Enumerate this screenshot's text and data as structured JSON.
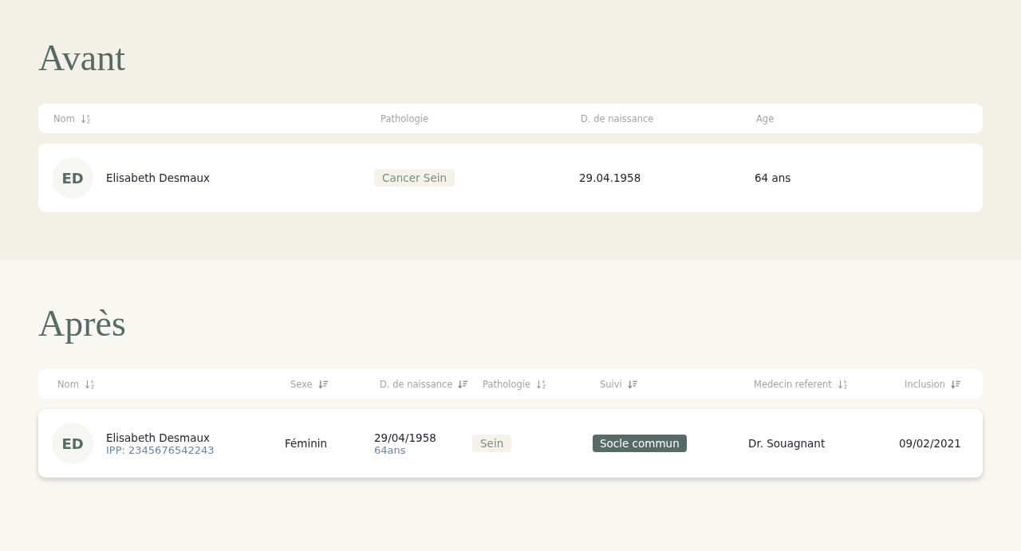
{
  "sections": [
    {
      "title": "Avant",
      "kind": "before",
      "columns": [
        {
          "label": "Nom",
          "kind": "alpha"
        },
        {
          "label": "Pathologie",
          "kind": "plain"
        },
        {
          "label": "D. de naissance",
          "kind": "plain"
        },
        {
          "label": "Age",
          "kind": "plain"
        }
      ],
      "rows": [
        {
          "cells": [
            {
              "kind": "person",
              "initials": "ED",
              "name": "Elisabeth Desmaux"
            },
            {
              "kind": "tag",
              "text": "Cancer Sein"
            },
            {
              "kind": "text",
              "text": "29.04.1958"
            },
            {
              "kind": "text",
              "text": "64 ans"
            }
          ]
        }
      ]
    },
    {
      "title": "Après",
      "kind": "after",
      "columns": [
        {
          "label": "Nom",
          "kind": "alpha"
        },
        {
          "label": "Sexe",
          "kind": "lines"
        },
        {
          "label": "D. de naissance",
          "kind": "lines"
        },
        {
          "label": "Pathologie",
          "kind": "alpha"
        },
        {
          "label": "Suivi",
          "kind": "lines"
        },
        {
          "label": "Medecin referent",
          "kind": "alpha"
        },
        {
          "label": "Inclusion",
          "kind": "lines"
        }
      ],
      "rows": [
        {
          "cells": [
            {
              "kind": "person",
              "initials": "ED",
              "name": "Elisabeth Desmaux",
              "sub": "IPP: 2345676542243"
            },
            {
              "kind": "text",
              "text": "Féminin"
            },
            {
              "kind": "text",
              "text": "29/04/1958",
              "sub": "64ans"
            },
            {
              "kind": "tag",
              "text": "Sein"
            },
            {
              "kind": "badge",
              "text": "Socle commun"
            },
            {
              "kind": "text",
              "text": "Dr. Souagnant"
            },
            {
              "kind": "text",
              "text": "09/02/2021"
            }
          ]
        }
      ]
    }
  ]
}
